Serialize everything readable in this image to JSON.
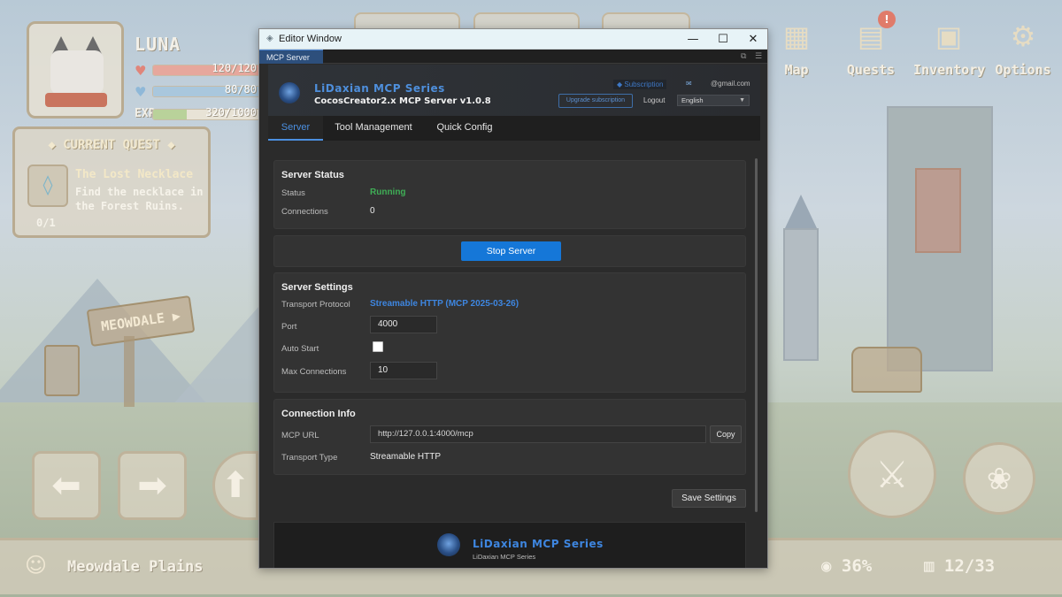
{
  "game": {
    "player": {
      "name": "LUNA",
      "hp": "120/120",
      "hp_fraction": 1.0,
      "mp": "80/80",
      "mp_fraction": 1.0,
      "exp_label": "EXP",
      "exp": "320/1000",
      "exp_fraction": 0.32
    },
    "quest": {
      "header": "CURRENT QUEST",
      "name": "The Lost Necklace",
      "description": "Find the necklace in the Forest Ruins.",
      "progress": "0/1"
    },
    "menu": {
      "map": "Map",
      "quests": "Quests",
      "quest_badge": "!",
      "inventory": "Inventory",
      "options": "Options"
    },
    "sign": "MEOWDALE",
    "location": "Meowdale Plains",
    "completion": "36%",
    "chests": "12/33"
  },
  "window": {
    "title": "Editor Window",
    "panel_tab": "MCP Server"
  },
  "header": {
    "brand": "LiDaxian MCP Series",
    "product": "CocosCreator2.x MCP Server v1.0.8",
    "subscription": "Subscription",
    "email": "@gmail.com",
    "upgrade": "Upgrade subscription",
    "logout": "Logout",
    "language": "English"
  },
  "tabs": {
    "server": "Server",
    "tools": "Tool Management",
    "quick": "Quick Config"
  },
  "status": {
    "title": "Server Status",
    "status_label": "Status",
    "status_value": "Running",
    "connections_label": "Connections",
    "connections_value": "0"
  },
  "actions": {
    "stop": "Stop Server",
    "save": "Save Settings",
    "copy": "Copy"
  },
  "settings": {
    "title": "Server Settings",
    "transport_label": "Transport Protocol",
    "transport_value": "Streamable HTTP (MCP 2025-03-26)",
    "port_label": "Port",
    "port_value": "4000",
    "auto_start_label": "Auto Start",
    "auto_start_checked": false,
    "max_conn_label": "Max Connections",
    "max_conn_value": "10"
  },
  "connection": {
    "title": "Connection Info",
    "url_label": "MCP URL",
    "url_value": "http://127.0.0.1:4000/mcp",
    "transport_type_label": "Transport Type",
    "transport_type_value": "Streamable HTTP"
  },
  "footer": {
    "title": "LiDaxian MCP Series",
    "subtitle": "LiDaxian MCP Series"
  },
  "colors": {
    "accent": "#1577d8",
    "running": "#3fae56",
    "link": "#3e86e0"
  }
}
